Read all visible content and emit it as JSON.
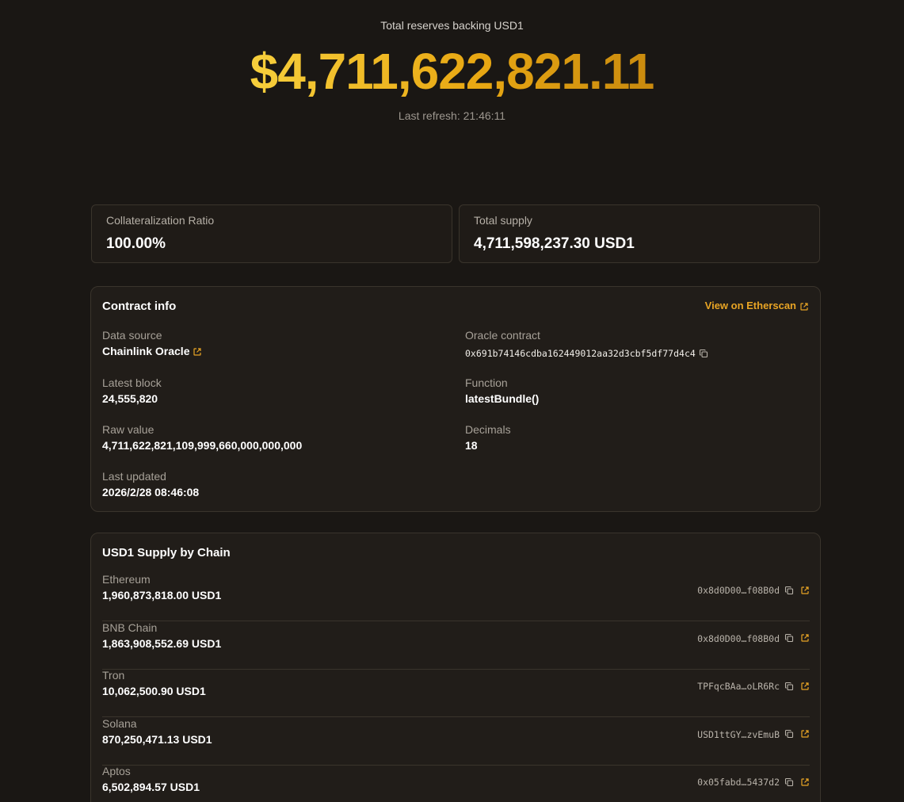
{
  "hero": {
    "label": "Total reserves backing USD1",
    "amount": "$4,711,622,821.11",
    "refresh": "Last refresh: 21:46:11"
  },
  "stats": {
    "ratio_label": "Collateralization Ratio",
    "ratio_value": "100.00%",
    "supply_label": "Total supply",
    "supply_value": "4,711,598,237.30 USD1"
  },
  "contract": {
    "title": "Contract info",
    "etherscan_label": "View on Etherscan",
    "data_source_label": "Data source",
    "data_source_value": "Chainlink Oracle",
    "oracle_label": "Oracle contract",
    "oracle_value": "0x691b74146cdba162449012aa32d3cbf5df77d4c4",
    "block_label": "Latest block",
    "block_value": "24,555,820",
    "function_label": "Function",
    "function_value": "latestBundle()",
    "raw_label": "Raw value",
    "raw_value": "4,711,622,821,109,999,660,000,000,000",
    "decimals_label": "Decimals",
    "decimals_value": "18",
    "updated_label": "Last updated",
    "updated_value": "2026/2/28 08:46:08"
  },
  "supply": {
    "title": "USD1 Supply by Chain",
    "chains": [
      {
        "name": "Ethereum",
        "supply": "1,960,873,818.00 USD1",
        "address": "0x8d0D00…f08B0d"
      },
      {
        "name": "BNB Chain",
        "supply": "1,863,908,552.69 USD1",
        "address": "0x8d0D00…f08B0d"
      },
      {
        "name": "Tron",
        "supply": "10,062,500.90 USD1",
        "address": "TPFqcBAa…oLR6Rc"
      },
      {
        "name": "Solana",
        "supply": "870,250,471.13 USD1",
        "address": "USD1ttGY…zvEmuB"
      },
      {
        "name": "Aptos",
        "supply": "6,502,894.57 USD1",
        "address": "0x05fabd…5437d2"
      }
    ]
  },
  "colors": {
    "accent": "#e8a424",
    "background": "#1a1714",
    "card": "#211d19",
    "border": "#3a342c"
  },
  "icons": {
    "external_link": "external-link-icon",
    "copy": "copy-icon"
  }
}
